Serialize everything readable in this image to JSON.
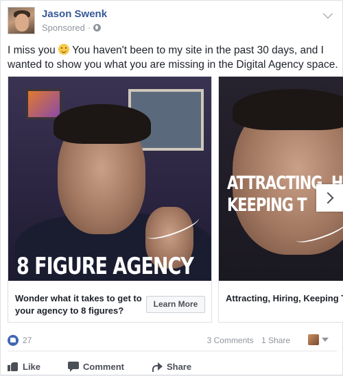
{
  "post": {
    "author": "Jason Swenk",
    "sponsored_label": "Sponsored",
    "meta_sep": "·",
    "message_part1": "I miss you",
    "message_part2": "You haven't been to my site in the past 30 days, and I wanted to show you what you are missing in the Digital Agency space."
  },
  "carousel": {
    "cards": [
      {
        "image_caption": "8 FIGURE AGENCY",
        "headline": "Wonder what it takes to get to your agency to 8 figures?",
        "cta_label": "Learn More"
      },
      {
        "image_caption_line1": "ATTRACTING, H",
        "image_caption_line2": "KEEPING T",
        "headline": "Attracting, Hiring, Keeping Top Talent"
      }
    ]
  },
  "engagement": {
    "like_count": "27",
    "comments": "3 Comments",
    "shares": "1 Share"
  },
  "actions": {
    "like": "Like",
    "comment": "Comment",
    "share": "Share"
  },
  "colors": {
    "brand_blue": "#365899",
    "like_blue": "#4267b2",
    "muted": "#90949c"
  },
  "icons": [
    "globe-icon",
    "chevron-down-icon",
    "smile-emoji-icon",
    "chevron-right-icon",
    "like-reaction-icon",
    "thumbs-up-icon",
    "comment-icon",
    "share-icon"
  ]
}
